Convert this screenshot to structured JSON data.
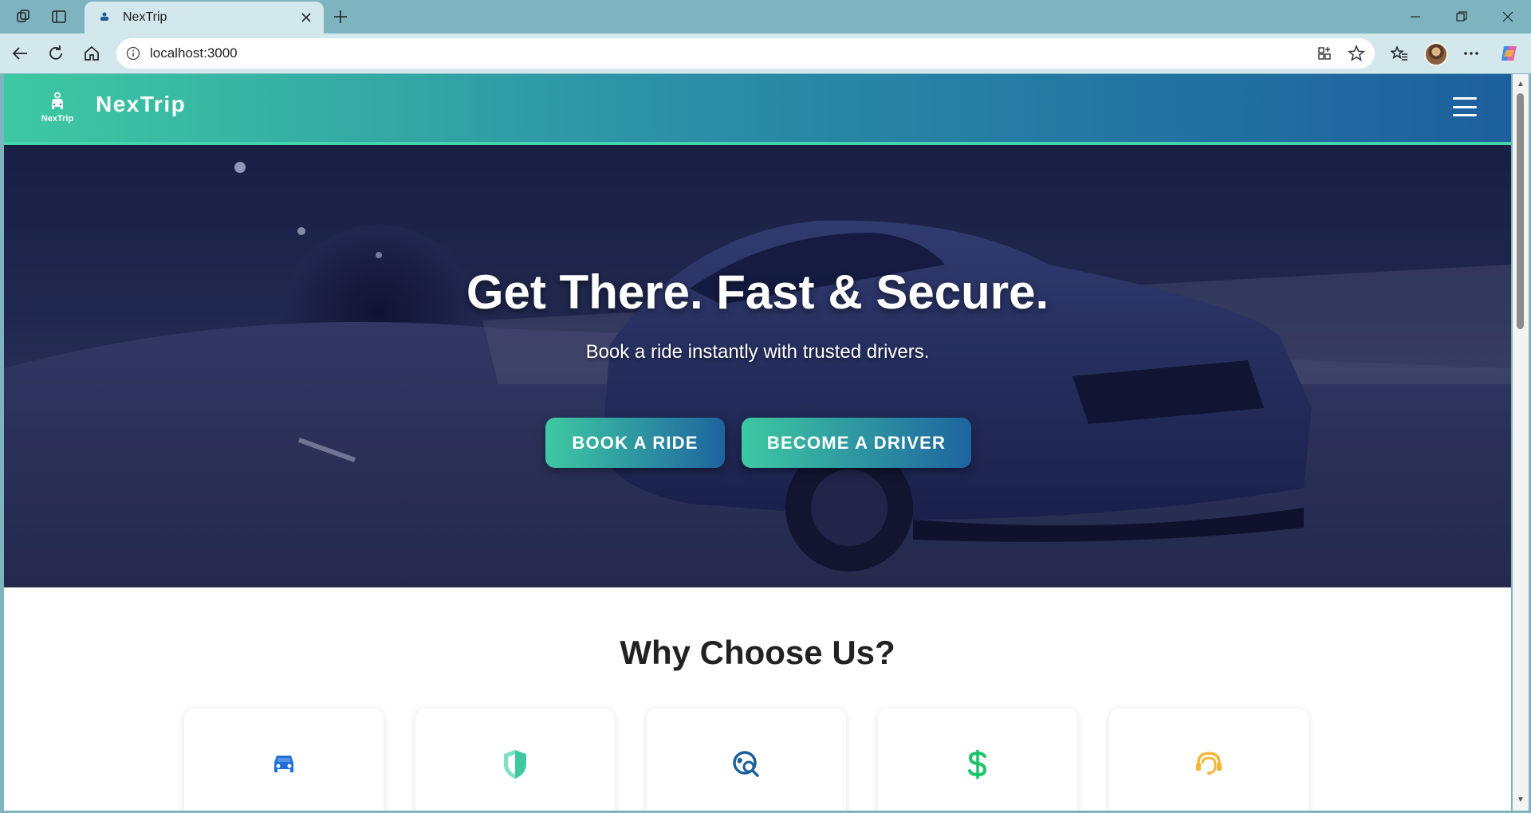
{
  "browser": {
    "tab_title": "NexTrip",
    "url": "localhost:3000"
  },
  "header": {
    "logo_text": "NexTrip",
    "brand": "NexTrip"
  },
  "hero": {
    "title": "Get There. Fast & Secure.",
    "subtitle": "Book a ride instantly with trusted drivers.",
    "book_label": "BOOK A RIDE",
    "driver_label": "BECOME A DRIVER"
  },
  "why": {
    "title": "Why Choose Us?",
    "cards": [
      {
        "icon": "car-icon",
        "color": "#1e6fd9"
      },
      {
        "icon": "shield-icon",
        "color": "#3ec9a2"
      },
      {
        "icon": "location-search-icon",
        "color": "#1d5f9e"
      },
      {
        "icon": "dollar-icon",
        "color": "#1bc46a"
      },
      {
        "icon": "support-agent-icon",
        "color": "#f4b63a"
      }
    ]
  },
  "colors": {
    "brand_start": "#3ec9a2",
    "brand_end": "#1d5f9e"
  }
}
